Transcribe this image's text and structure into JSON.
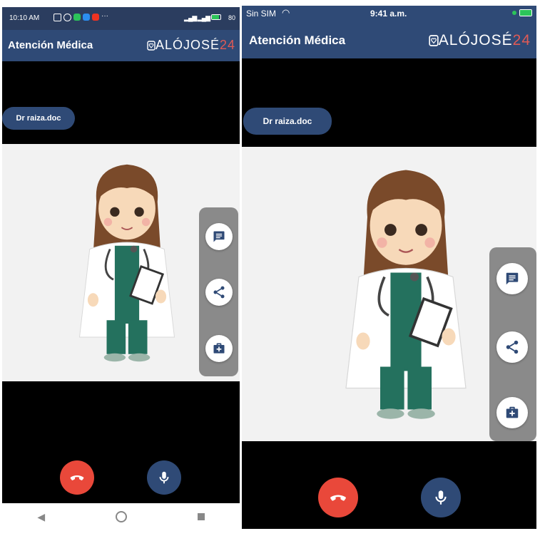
{
  "android": {
    "status_time": "10:10 AM",
    "battery": "80",
    "app_title": "Atención Médica",
    "doctor_label": "Dr raiza.doc"
  },
  "ios": {
    "carrier": "Sin SIM",
    "status_time": "9:41 a.m.",
    "app_title": "Atención Médica",
    "doctor_label": "Dr raiza.doc"
  },
  "logo": {
    "text": "ALÓJOSÉ",
    "number": "24"
  },
  "side_actions": [
    "chat-icon",
    "share-icon",
    "medical-kit-icon"
  ],
  "colors": {
    "primary": "#2f4a76",
    "hangup": "#e9483a",
    "logo_accent": "#e05a55"
  }
}
